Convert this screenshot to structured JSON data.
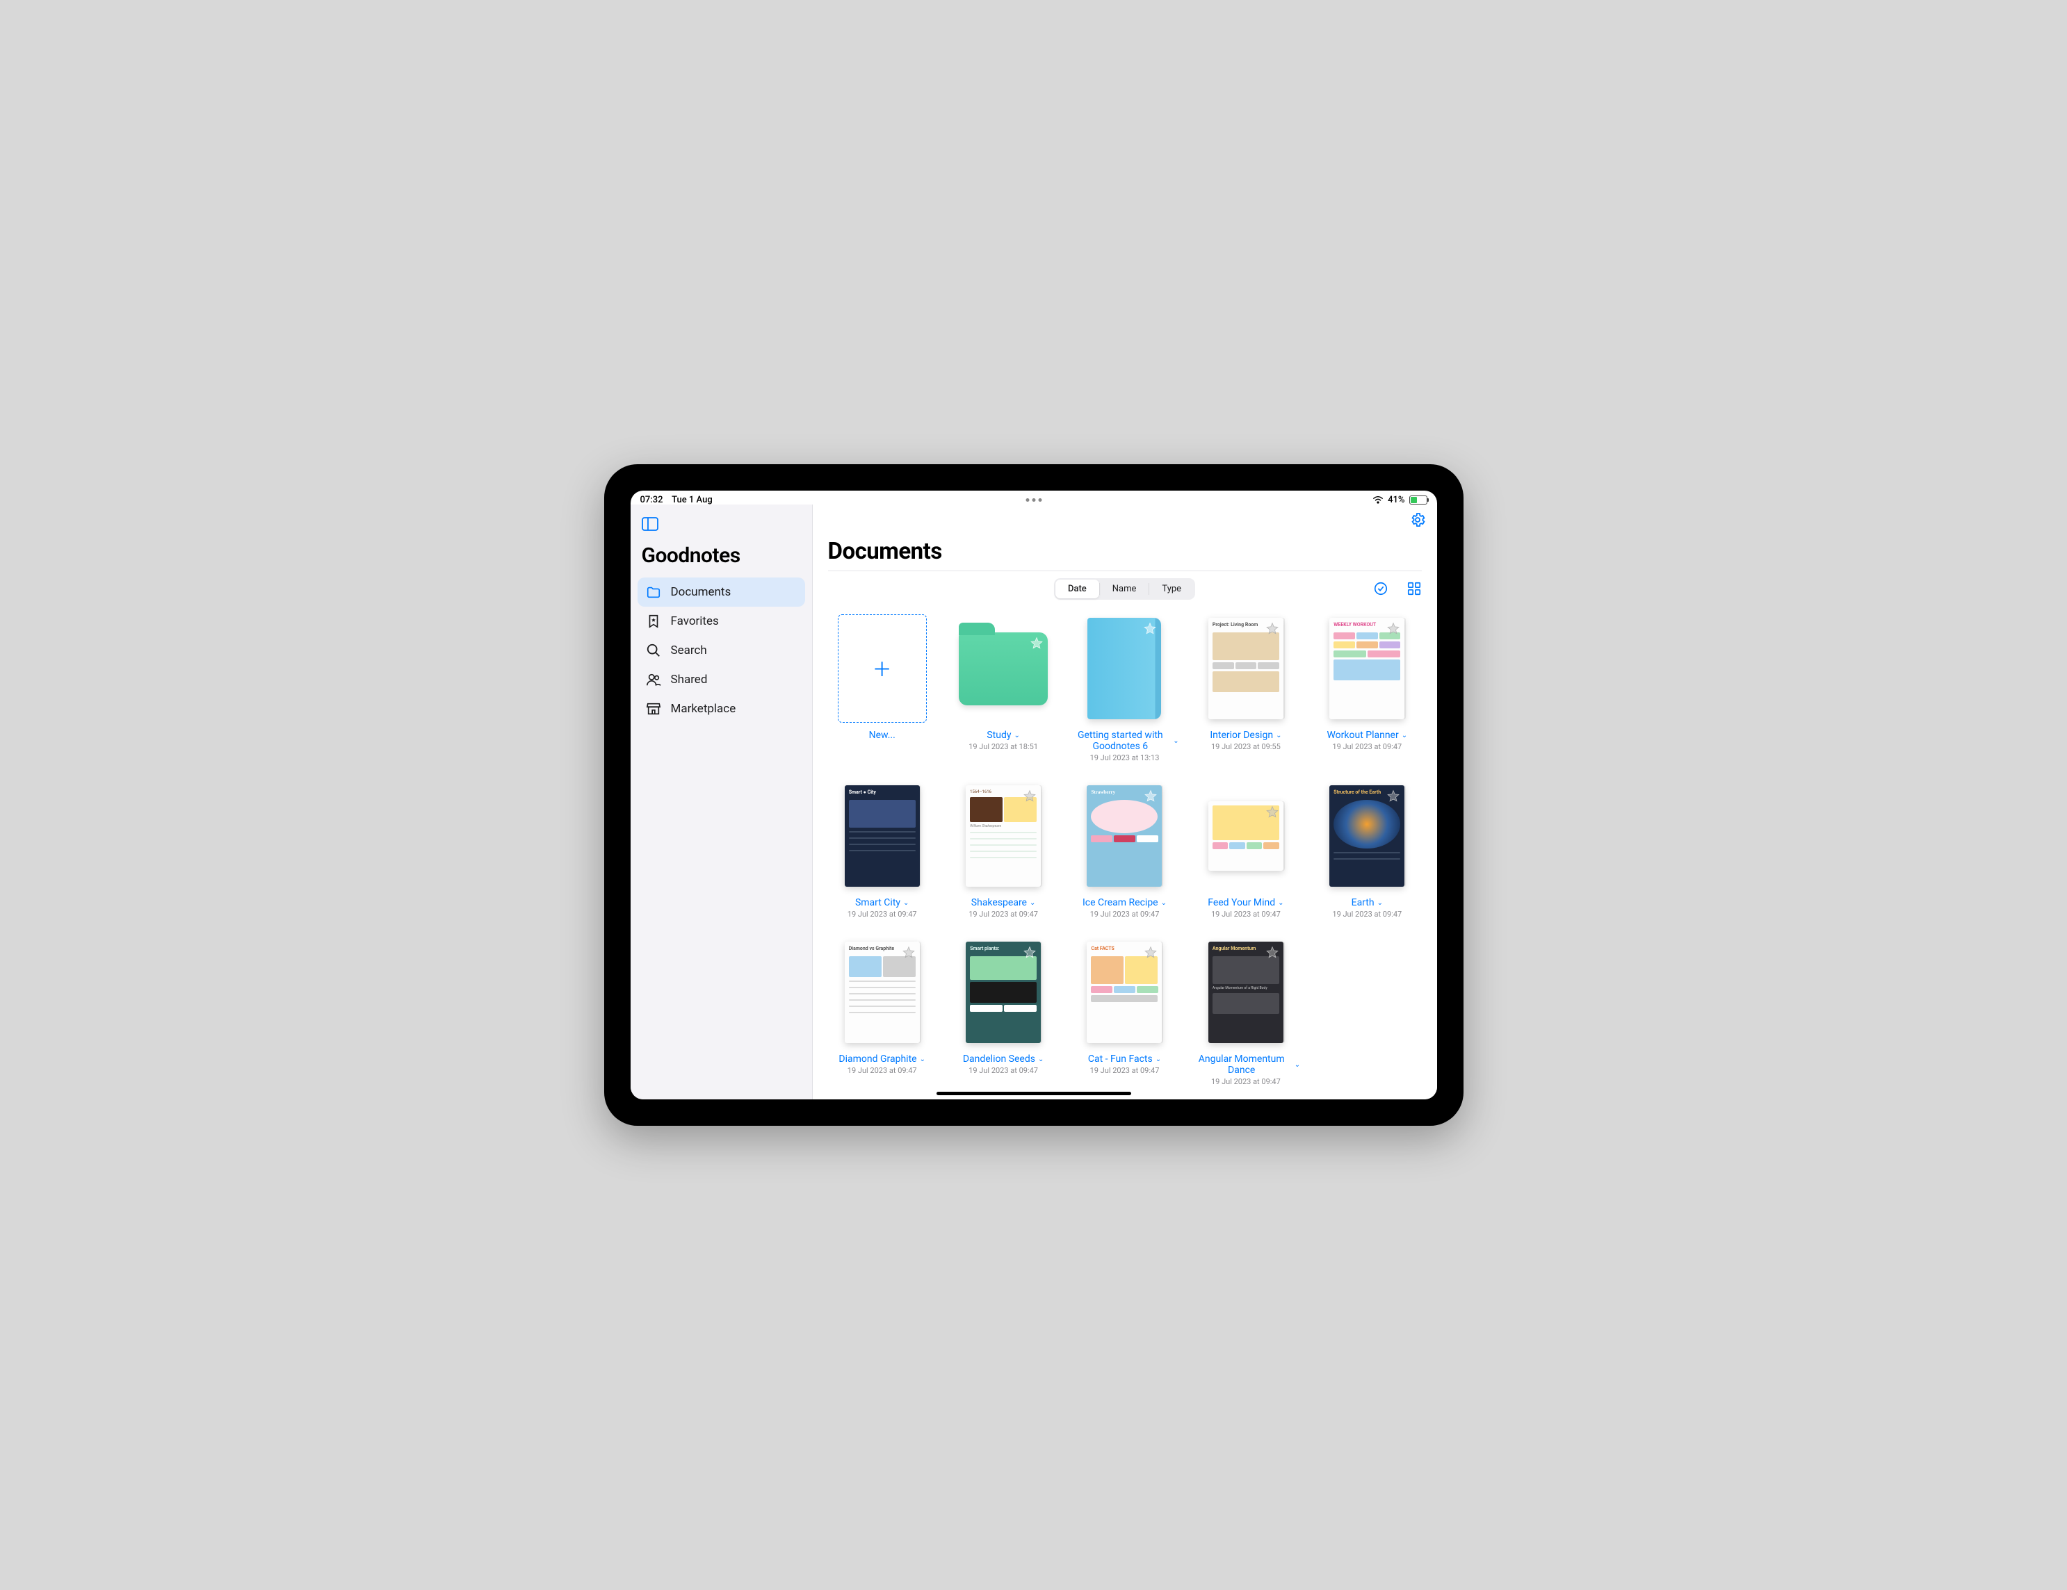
{
  "status": {
    "time": "07:32",
    "date": "Tue 1 Aug",
    "battery_pct": "41%"
  },
  "sidebar": {
    "appTitle": "Goodnotes",
    "items": [
      {
        "label": "Documents",
        "icon": "folder",
        "active": true
      },
      {
        "label": "Favorites",
        "icon": "star",
        "active": false
      },
      {
        "label": "Search",
        "icon": "search",
        "active": false
      },
      {
        "label": "Shared",
        "icon": "shared",
        "active": false
      },
      {
        "label": "Marketplace",
        "icon": "market",
        "active": false
      }
    ]
  },
  "main": {
    "title": "Documents",
    "sort": {
      "options": [
        "Date",
        "Name",
        "Type"
      ],
      "active": "Date"
    },
    "newLabel": "New...",
    "items": [
      {
        "name": "Study",
        "date": "19 Jul 2023 at 18:51",
        "kind": "folder",
        "accent": "",
        "star": true
      },
      {
        "name": "Getting started with Goodnotes 6",
        "date": "19 Jul 2023 at 13:13",
        "kind": "notebook",
        "accent": "",
        "star": true
      },
      {
        "name": "Interior Design",
        "date": "19 Jul 2023 at 09:55",
        "kind": "page",
        "accent": "white",
        "star": true
      },
      {
        "name": "Workout Planner",
        "date": "19 Jul 2023 at 09:47",
        "kind": "page",
        "accent": "white",
        "star": true
      },
      {
        "name": "Smart City",
        "date": "19 Jul 2023 at 09:47",
        "kind": "page",
        "accent": "dark",
        "star": false
      },
      {
        "name": "Shakespeare",
        "date": "19 Jul 2023 at 09:47",
        "kind": "page",
        "accent": "white",
        "star": true
      },
      {
        "name": "Ice Cream Recipe",
        "date": "19 Jul 2023 at 09:47",
        "kind": "page",
        "accent": "blue",
        "star": true
      },
      {
        "name": "Feed Your Mind",
        "date": "19 Jul 2023 at 09:47",
        "kind": "page",
        "accent": "white",
        "star": true
      },
      {
        "name": "Earth",
        "date": "19 Jul 2023 at 09:47",
        "kind": "page",
        "accent": "dark",
        "star": true
      },
      {
        "name": "Diamond Graphite",
        "date": "19 Jul 2023 at 09:47",
        "kind": "page",
        "accent": "white",
        "star": true
      },
      {
        "name": "Dandelion Seeds",
        "date": "19 Jul 2023 at 09:47",
        "kind": "page",
        "accent": "teal",
        "star": true
      },
      {
        "name": "Cat - Fun Facts",
        "date": "19 Jul 2023 at 09:47",
        "kind": "page",
        "accent": "white",
        "star": true
      },
      {
        "name": "Angular Momentum Dance",
        "date": "19 Jul 2023 at 09:47",
        "kind": "page",
        "accent": "dark2",
        "star": true
      }
    ]
  }
}
